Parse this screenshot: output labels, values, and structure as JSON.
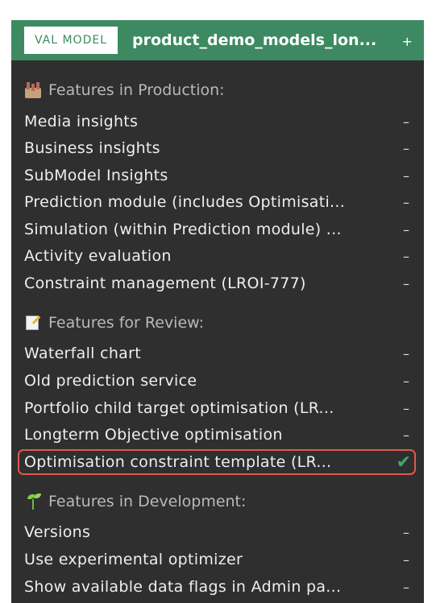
{
  "header": {
    "badge": "VAL MODEL",
    "title": "product_demo_models_lon...",
    "add_symbol": "+"
  },
  "sections": [
    {
      "icon": "factory-icon",
      "title": "Features in Production:",
      "items": [
        {
          "label": "Media insights",
          "status": "–"
        },
        {
          "label": "Business insights",
          "status": "–"
        },
        {
          "label": "SubModel Insights",
          "status": "–"
        },
        {
          "label": "Prediction module (includes Optimisati...",
          "status": "–"
        },
        {
          "label": "Simulation (within Prediction module) ...",
          "status": "–"
        },
        {
          "label": "Activity evaluation",
          "status": "–"
        },
        {
          "label": "Constraint management (LROI-777)",
          "status": "–"
        }
      ]
    },
    {
      "icon": "memo-icon",
      "title": "Features for Review:",
      "items": [
        {
          "label": "Waterfall chart",
          "status": "–"
        },
        {
          "label": "Old prediction service",
          "status": "–"
        },
        {
          "label": "Portfolio child target optimisation (LR...",
          "status": "–"
        },
        {
          "label": "Longterm Objective optimisation",
          "status": "–"
        },
        {
          "label": "Optimisation constraint template (LR...",
          "status": "✔",
          "selected": true
        }
      ]
    },
    {
      "icon": "sprout-icon",
      "title": "Features in Development:",
      "items": [
        {
          "label": "Versions",
          "status": "–"
        },
        {
          "label": "Use experimental optimizer",
          "status": "–"
        },
        {
          "label": "Show available data flags in Admin pa...",
          "status": "–"
        }
      ]
    }
  ],
  "colors": {
    "header_bg": "#3d8a62",
    "panel_bg": "#2f2f2f",
    "selected_border": "#e05a4e",
    "check": "#3daa6a"
  }
}
